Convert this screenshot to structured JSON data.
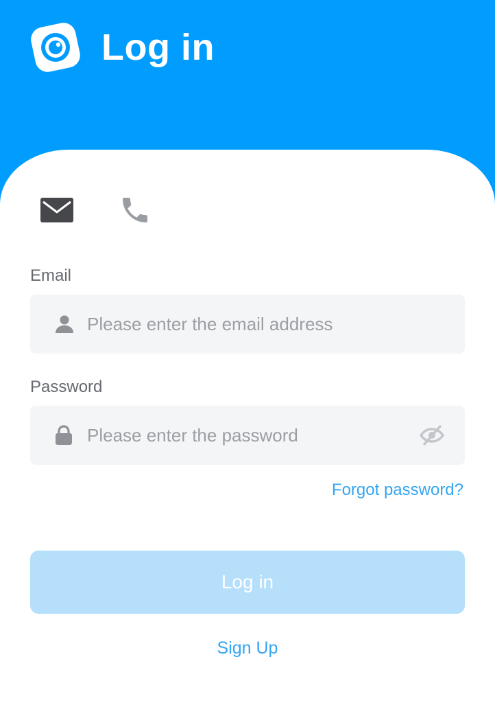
{
  "header": {
    "title": "Log in",
    "logo_icon": "camera-eye-logo",
    "background_color": "#009dff"
  },
  "login_methods": {
    "email_icon": "envelope-icon",
    "phone_icon": "phone-icon",
    "active": "email"
  },
  "form": {
    "email_label": "Email",
    "email_placeholder": "Please enter the email address",
    "email_icon": "user-icon",
    "password_label": "Password",
    "password_placeholder": "Please enter the password",
    "password_icon": "lock-icon",
    "visibility_icon": "eye-off-icon"
  },
  "links": {
    "forgot_password": "Forgot password?",
    "sign_up": "Sign Up"
  },
  "buttons": {
    "login": "Log in"
  },
  "colors": {
    "accent": "#009dff",
    "link": "#33a5f1",
    "button_disabled": "#b5dffb",
    "input_background": "#f4f5f7"
  }
}
